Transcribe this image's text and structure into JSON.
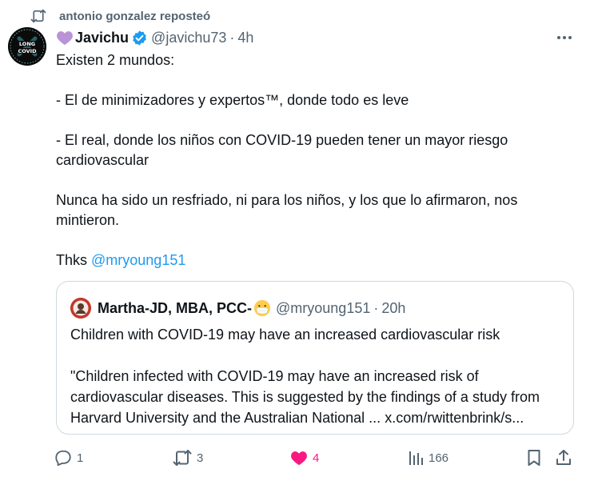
{
  "repost": {
    "icon": "repost-icon",
    "label": "antonio gonzalez reposteó"
  },
  "tweet": {
    "avatar_text": [
      "LONG",
      "COVID"
    ],
    "name_prefix_icon": "purple-heart-icon",
    "name": "Javichu",
    "verified_icon": "verified-badge-icon",
    "handle": "@javichu73",
    "separator": "·",
    "time": "4h",
    "text_lines": [
      "Existen 2 mundos:",
      "",
      "-  El de minimizadores y expertos™, donde todo es leve",
      "",
      "- El real, donde los niños con COVID-19 pueden tener un mayor riesgo",
      "cardiovascular",
      "",
      "Nunca ha sido un resfriado, ni para los niños, y los que lo afirmaron, nos",
      "mintieron.",
      ""
    ],
    "thanks_prefix": "Thks ",
    "thanks_mention": "@mryoung151"
  },
  "quote": {
    "name": "Martha-JD, MBA, PCC-",
    "emoji": "mask-face-emoji",
    "handle": "@mryoung151",
    "separator": "·",
    "time": "20h",
    "text_lines": [
      "Children with COVID-19 may have an increased cardiovascular risk",
      "",
      "\"Children infected with COVID-19 may have an increased risk of",
      "cardiovascular diseases. This is suggested by the findings of a study from",
      "Harvard University and the Australian National ... x.com/rwittenbrink/s..."
    ]
  },
  "actions": {
    "reply_count": "1",
    "repost_count": "3",
    "like_count": "4",
    "views_count": "166"
  },
  "colors": {
    "accent": "#1d9bf0",
    "like": "#f91880",
    "muted": "#536471",
    "text": "#0f1419",
    "border": "#cfd9de"
  }
}
